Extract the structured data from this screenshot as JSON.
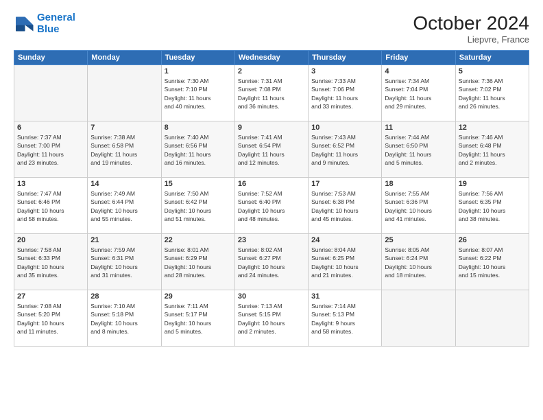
{
  "logo": {
    "line1": "General",
    "line2": "Blue"
  },
  "title": "October 2024",
  "location": "Liepvre, France",
  "days_header": [
    "Sunday",
    "Monday",
    "Tuesday",
    "Wednesday",
    "Thursday",
    "Friday",
    "Saturday"
  ],
  "weeks": [
    [
      {
        "num": "",
        "info": "",
        "empty": true
      },
      {
        "num": "",
        "info": "",
        "empty": true
      },
      {
        "num": "1",
        "info": "Sunrise: 7:30 AM\nSunset: 7:10 PM\nDaylight: 11 hours\nand 40 minutes.",
        "empty": false
      },
      {
        "num": "2",
        "info": "Sunrise: 7:31 AM\nSunset: 7:08 PM\nDaylight: 11 hours\nand 36 minutes.",
        "empty": false
      },
      {
        "num": "3",
        "info": "Sunrise: 7:33 AM\nSunset: 7:06 PM\nDaylight: 11 hours\nand 33 minutes.",
        "empty": false
      },
      {
        "num": "4",
        "info": "Sunrise: 7:34 AM\nSunset: 7:04 PM\nDaylight: 11 hours\nand 29 minutes.",
        "empty": false
      },
      {
        "num": "5",
        "info": "Sunrise: 7:36 AM\nSunset: 7:02 PM\nDaylight: 11 hours\nand 26 minutes.",
        "empty": false
      }
    ],
    [
      {
        "num": "6",
        "info": "Sunrise: 7:37 AM\nSunset: 7:00 PM\nDaylight: 11 hours\nand 23 minutes.",
        "empty": false
      },
      {
        "num": "7",
        "info": "Sunrise: 7:38 AM\nSunset: 6:58 PM\nDaylight: 11 hours\nand 19 minutes.",
        "empty": false
      },
      {
        "num": "8",
        "info": "Sunrise: 7:40 AM\nSunset: 6:56 PM\nDaylight: 11 hours\nand 16 minutes.",
        "empty": false
      },
      {
        "num": "9",
        "info": "Sunrise: 7:41 AM\nSunset: 6:54 PM\nDaylight: 11 hours\nand 12 minutes.",
        "empty": false
      },
      {
        "num": "10",
        "info": "Sunrise: 7:43 AM\nSunset: 6:52 PM\nDaylight: 11 hours\nand 9 minutes.",
        "empty": false
      },
      {
        "num": "11",
        "info": "Sunrise: 7:44 AM\nSunset: 6:50 PM\nDaylight: 11 hours\nand 5 minutes.",
        "empty": false
      },
      {
        "num": "12",
        "info": "Sunrise: 7:46 AM\nSunset: 6:48 PM\nDaylight: 11 hours\nand 2 minutes.",
        "empty": false
      }
    ],
    [
      {
        "num": "13",
        "info": "Sunrise: 7:47 AM\nSunset: 6:46 PM\nDaylight: 10 hours\nand 58 minutes.",
        "empty": false
      },
      {
        "num": "14",
        "info": "Sunrise: 7:49 AM\nSunset: 6:44 PM\nDaylight: 10 hours\nand 55 minutes.",
        "empty": false
      },
      {
        "num": "15",
        "info": "Sunrise: 7:50 AM\nSunset: 6:42 PM\nDaylight: 10 hours\nand 51 minutes.",
        "empty": false
      },
      {
        "num": "16",
        "info": "Sunrise: 7:52 AM\nSunset: 6:40 PM\nDaylight: 10 hours\nand 48 minutes.",
        "empty": false
      },
      {
        "num": "17",
        "info": "Sunrise: 7:53 AM\nSunset: 6:38 PM\nDaylight: 10 hours\nand 45 minutes.",
        "empty": false
      },
      {
        "num": "18",
        "info": "Sunrise: 7:55 AM\nSunset: 6:36 PM\nDaylight: 10 hours\nand 41 minutes.",
        "empty": false
      },
      {
        "num": "19",
        "info": "Sunrise: 7:56 AM\nSunset: 6:35 PM\nDaylight: 10 hours\nand 38 minutes.",
        "empty": false
      }
    ],
    [
      {
        "num": "20",
        "info": "Sunrise: 7:58 AM\nSunset: 6:33 PM\nDaylight: 10 hours\nand 35 minutes.",
        "empty": false
      },
      {
        "num": "21",
        "info": "Sunrise: 7:59 AM\nSunset: 6:31 PM\nDaylight: 10 hours\nand 31 minutes.",
        "empty": false
      },
      {
        "num": "22",
        "info": "Sunrise: 8:01 AM\nSunset: 6:29 PM\nDaylight: 10 hours\nand 28 minutes.",
        "empty": false
      },
      {
        "num": "23",
        "info": "Sunrise: 8:02 AM\nSunset: 6:27 PM\nDaylight: 10 hours\nand 24 minutes.",
        "empty": false
      },
      {
        "num": "24",
        "info": "Sunrise: 8:04 AM\nSunset: 6:25 PM\nDaylight: 10 hours\nand 21 minutes.",
        "empty": false
      },
      {
        "num": "25",
        "info": "Sunrise: 8:05 AM\nSunset: 6:24 PM\nDaylight: 10 hours\nand 18 minutes.",
        "empty": false
      },
      {
        "num": "26",
        "info": "Sunrise: 8:07 AM\nSunset: 6:22 PM\nDaylight: 10 hours\nand 15 minutes.",
        "empty": false
      }
    ],
    [
      {
        "num": "27",
        "info": "Sunrise: 7:08 AM\nSunset: 5:20 PM\nDaylight: 10 hours\nand 11 minutes.",
        "empty": false
      },
      {
        "num": "28",
        "info": "Sunrise: 7:10 AM\nSunset: 5:18 PM\nDaylight: 10 hours\nand 8 minutes.",
        "empty": false
      },
      {
        "num": "29",
        "info": "Sunrise: 7:11 AM\nSunset: 5:17 PM\nDaylight: 10 hours\nand 5 minutes.",
        "empty": false
      },
      {
        "num": "30",
        "info": "Sunrise: 7:13 AM\nSunset: 5:15 PM\nDaylight: 10 hours\nand 2 minutes.",
        "empty": false
      },
      {
        "num": "31",
        "info": "Sunrise: 7:14 AM\nSunset: 5:13 PM\nDaylight: 9 hours\nand 58 minutes.",
        "empty": false
      },
      {
        "num": "",
        "info": "",
        "empty": true
      },
      {
        "num": "",
        "info": "",
        "empty": true
      }
    ]
  ]
}
